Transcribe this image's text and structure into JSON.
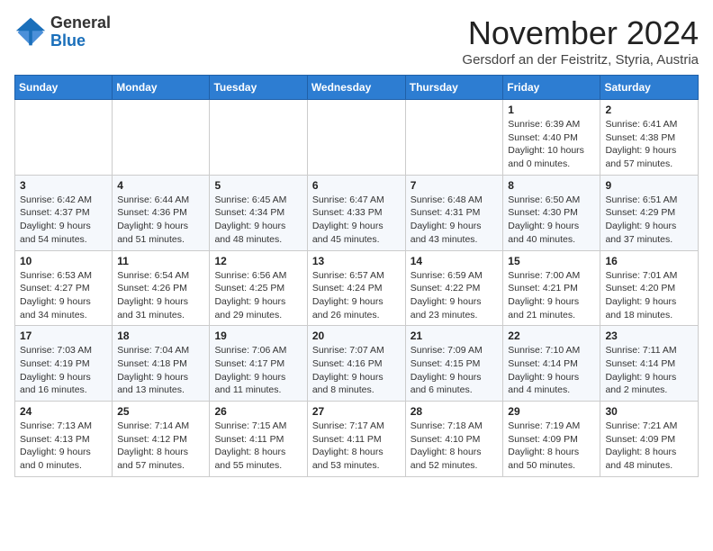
{
  "logo": {
    "general": "General",
    "blue": "Blue"
  },
  "header": {
    "month_title": "November 2024",
    "subtitle": "Gersdorf an der Feistritz, Styria, Austria"
  },
  "calendar": {
    "days_of_week": [
      "Sunday",
      "Monday",
      "Tuesday",
      "Wednesday",
      "Thursday",
      "Friday",
      "Saturday"
    ],
    "weeks": [
      {
        "days": [
          {
            "number": "",
            "detail": ""
          },
          {
            "number": "",
            "detail": ""
          },
          {
            "number": "",
            "detail": ""
          },
          {
            "number": "",
            "detail": ""
          },
          {
            "number": "",
            "detail": ""
          },
          {
            "number": "1",
            "detail": "Sunrise: 6:39 AM\nSunset: 4:40 PM\nDaylight: 10 hours and 0 minutes."
          },
          {
            "number": "2",
            "detail": "Sunrise: 6:41 AM\nSunset: 4:38 PM\nDaylight: 9 hours and 57 minutes."
          }
        ]
      },
      {
        "days": [
          {
            "number": "3",
            "detail": "Sunrise: 6:42 AM\nSunset: 4:37 PM\nDaylight: 9 hours and 54 minutes."
          },
          {
            "number": "4",
            "detail": "Sunrise: 6:44 AM\nSunset: 4:36 PM\nDaylight: 9 hours and 51 minutes."
          },
          {
            "number": "5",
            "detail": "Sunrise: 6:45 AM\nSunset: 4:34 PM\nDaylight: 9 hours and 48 minutes."
          },
          {
            "number": "6",
            "detail": "Sunrise: 6:47 AM\nSunset: 4:33 PM\nDaylight: 9 hours and 45 minutes."
          },
          {
            "number": "7",
            "detail": "Sunrise: 6:48 AM\nSunset: 4:31 PM\nDaylight: 9 hours and 43 minutes."
          },
          {
            "number": "8",
            "detail": "Sunrise: 6:50 AM\nSunset: 4:30 PM\nDaylight: 9 hours and 40 minutes."
          },
          {
            "number": "9",
            "detail": "Sunrise: 6:51 AM\nSunset: 4:29 PM\nDaylight: 9 hours and 37 minutes."
          }
        ]
      },
      {
        "days": [
          {
            "number": "10",
            "detail": "Sunrise: 6:53 AM\nSunset: 4:27 PM\nDaylight: 9 hours and 34 minutes."
          },
          {
            "number": "11",
            "detail": "Sunrise: 6:54 AM\nSunset: 4:26 PM\nDaylight: 9 hours and 31 minutes."
          },
          {
            "number": "12",
            "detail": "Sunrise: 6:56 AM\nSunset: 4:25 PM\nDaylight: 9 hours and 29 minutes."
          },
          {
            "number": "13",
            "detail": "Sunrise: 6:57 AM\nSunset: 4:24 PM\nDaylight: 9 hours and 26 minutes."
          },
          {
            "number": "14",
            "detail": "Sunrise: 6:59 AM\nSunset: 4:22 PM\nDaylight: 9 hours and 23 minutes."
          },
          {
            "number": "15",
            "detail": "Sunrise: 7:00 AM\nSunset: 4:21 PM\nDaylight: 9 hours and 21 minutes."
          },
          {
            "number": "16",
            "detail": "Sunrise: 7:01 AM\nSunset: 4:20 PM\nDaylight: 9 hours and 18 minutes."
          }
        ]
      },
      {
        "days": [
          {
            "number": "17",
            "detail": "Sunrise: 7:03 AM\nSunset: 4:19 PM\nDaylight: 9 hours and 16 minutes."
          },
          {
            "number": "18",
            "detail": "Sunrise: 7:04 AM\nSunset: 4:18 PM\nDaylight: 9 hours and 13 minutes."
          },
          {
            "number": "19",
            "detail": "Sunrise: 7:06 AM\nSunset: 4:17 PM\nDaylight: 9 hours and 11 minutes."
          },
          {
            "number": "20",
            "detail": "Sunrise: 7:07 AM\nSunset: 4:16 PM\nDaylight: 9 hours and 8 minutes."
          },
          {
            "number": "21",
            "detail": "Sunrise: 7:09 AM\nSunset: 4:15 PM\nDaylight: 9 hours and 6 minutes."
          },
          {
            "number": "22",
            "detail": "Sunrise: 7:10 AM\nSunset: 4:14 PM\nDaylight: 9 hours and 4 minutes."
          },
          {
            "number": "23",
            "detail": "Sunrise: 7:11 AM\nSunset: 4:14 PM\nDaylight: 9 hours and 2 minutes."
          }
        ]
      },
      {
        "days": [
          {
            "number": "24",
            "detail": "Sunrise: 7:13 AM\nSunset: 4:13 PM\nDaylight: 9 hours and 0 minutes."
          },
          {
            "number": "25",
            "detail": "Sunrise: 7:14 AM\nSunset: 4:12 PM\nDaylight: 8 hours and 57 minutes."
          },
          {
            "number": "26",
            "detail": "Sunrise: 7:15 AM\nSunset: 4:11 PM\nDaylight: 8 hours and 55 minutes."
          },
          {
            "number": "27",
            "detail": "Sunrise: 7:17 AM\nSunset: 4:11 PM\nDaylight: 8 hours and 53 minutes."
          },
          {
            "number": "28",
            "detail": "Sunrise: 7:18 AM\nSunset: 4:10 PM\nDaylight: 8 hours and 52 minutes."
          },
          {
            "number": "29",
            "detail": "Sunrise: 7:19 AM\nSunset: 4:09 PM\nDaylight: 8 hours and 50 minutes."
          },
          {
            "number": "30",
            "detail": "Sunrise: 7:21 AM\nSunset: 4:09 PM\nDaylight: 8 hours and 48 minutes."
          }
        ]
      }
    ]
  }
}
